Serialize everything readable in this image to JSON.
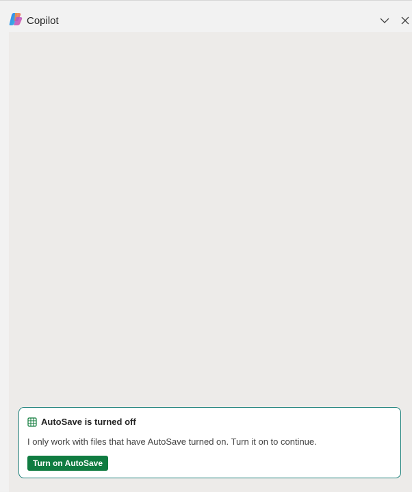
{
  "header": {
    "title": "Copilot",
    "logo_icon": "copilot-logo-icon",
    "collapse_icon": "chevron-down-icon",
    "close_icon": "close-icon"
  },
  "notice": {
    "icon": "spreadsheet-grid-icon",
    "title": "AutoSave is turned off",
    "message": "I only work with files that have AutoSave turned on. Turn it on to continue.",
    "button_label": "Turn on AutoSave",
    "border_color": "#1b7f79",
    "button_color": "#107c41"
  }
}
